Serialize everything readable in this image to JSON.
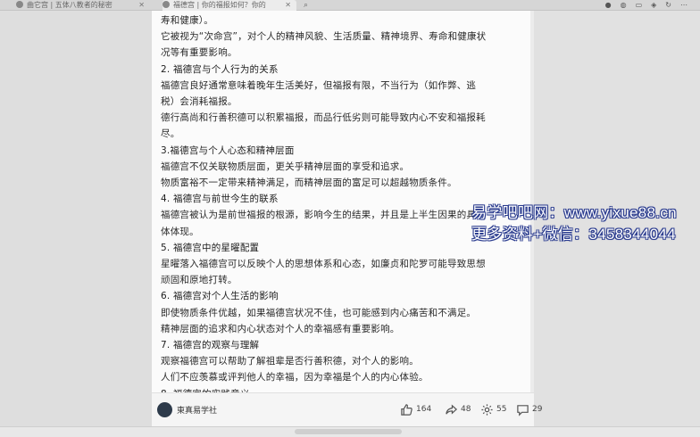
{
  "browser": {
    "tabs": [
      {
        "label": "曲它宫 | 五体八教者的秘密"
      },
      {
        "label": "福德宫 | 你的福报如何？你的"
      }
    ],
    "search_glyph": "⌕"
  },
  "article": {
    "lines": [
      {
        "text": "寿和健康）。",
        "heading": false
      },
      {
        "text": "它被视为“次命宫”，对个人的精神风貌、生活质量、精神境界、寿命和健康状",
        "heading": false
      },
      {
        "text": "况等有重要影响。",
        "heading": false
      },
      {
        "text": "2. 福德宫与个人行为的关系",
        "heading": true
      },
      {
        "text": "福德宫良好通常意味着晚年生活美好，但福报有限，不当行为（如作弊、逃",
        "heading": false
      },
      {
        "text": "税）会消耗福报。",
        "heading": false
      },
      {
        "text": "德行高尚和行善积德可以积累福报，而品行低劣则可能导致内心不安和福报耗",
        "heading": false
      },
      {
        "text": "尽。",
        "heading": false
      },
      {
        "text": "3.福德宫与个人心态和精神层面",
        "heading": true
      },
      {
        "text": "福德宫不仅关联物质层面，更关乎精神层面的享受和追求。",
        "heading": false
      },
      {
        "text": "物质富裕不一定带来精神满足，而精神层面的富足可以超越物质条件。",
        "heading": false
      },
      {
        "text": "4. 福德宫与前世今生的联系",
        "heading": true
      },
      {
        "text": "福德宫被认为是前世福报的根源，影响今生的结果，并且是上半生因果的具",
        "heading": false
      },
      {
        "text": "体体现。",
        "heading": false
      },
      {
        "text": "5. 福德宫中的星曜配置",
        "heading": true
      },
      {
        "text": "星曜落入福德宫可以反映个人的思想体系和心态，如廉贞和陀罗可能导致思想",
        "heading": false
      },
      {
        "text": "顽固和原地打转。",
        "heading": false
      },
      {
        "text": "6. 福德宫对个人生活的影响",
        "heading": true
      },
      {
        "text": "即使物质条件优越，如果福德宫状况不佳，也可能感到内心痛苦和不满足。",
        "heading": false
      },
      {
        "text": "精神层面的追求和内心状态对个人的幸福感有重要影响。",
        "heading": false
      },
      {
        "text": "7. 福德宫的观察与理解",
        "heading": true
      },
      {
        "text": "观察福德宫可以帮助了解祖辈是否行善积德，对个人的影响。",
        "heading": false
      },
      {
        "text": "人们不应羡慕或评判他人的幸福，因为幸福是个人的内心体验。",
        "heading": false
      },
      {
        "text": "8. 福德宫的实践意义",
        "heading": true
      }
    ]
  },
  "footer": {
    "author": "東真易学社",
    "likes": "164",
    "shares": "48",
    "settings_count": "55",
    "comments": "29"
  },
  "watermark": {
    "line1": "易学吧吧网：www.yixue88.cn",
    "line2": "更多资料+微信：3458344044",
    "color": "#2b3c8f"
  }
}
